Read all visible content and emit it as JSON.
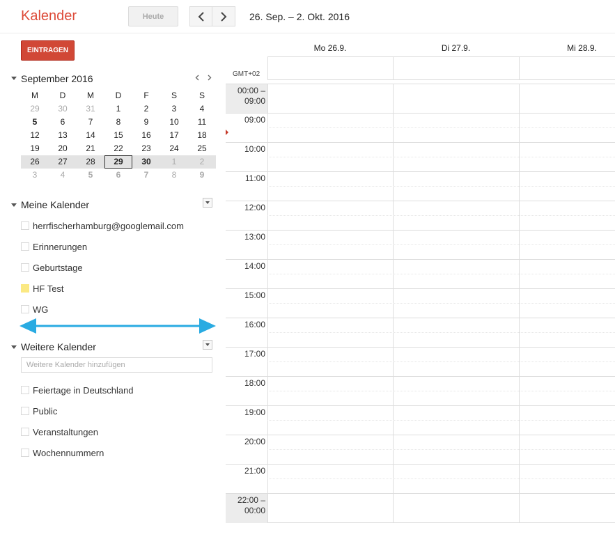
{
  "header": {
    "title": "Kalender",
    "today_label": "Heute",
    "date_range": "26. Sep. – 2. Okt. 2016"
  },
  "sidebar": {
    "create_label": "EINTRAGEN",
    "mini_calendar": {
      "title": "September 2016",
      "weekdays": [
        "M",
        "D",
        "M",
        "D",
        "F",
        "S",
        "S"
      ],
      "weeks": [
        [
          "29",
          "30",
          "31",
          "1",
          "2",
          "3",
          "4"
        ],
        [
          "5",
          "6",
          "7",
          "8",
          "9",
          "10",
          "11"
        ],
        [
          "12",
          "13",
          "14",
          "15",
          "16",
          "17",
          "18"
        ],
        [
          "19",
          "20",
          "21",
          "22",
          "23",
          "24",
          "25"
        ],
        [
          "26",
          "27",
          "28",
          "29",
          "30",
          "1",
          "2"
        ],
        [
          "3",
          "4",
          "5",
          "6",
          "7",
          "8",
          "9"
        ]
      ]
    },
    "my_calendars": {
      "title": "Meine Kalender",
      "items": [
        {
          "label": "herrfischerhamburg@googlemail.com",
          "color": "#ffffff"
        },
        {
          "label": "Erinnerungen",
          "color": "#ffffff"
        },
        {
          "label": "Geburtstage",
          "color": "#ffffff"
        },
        {
          "label": "HF Test",
          "color": "#fbe983"
        },
        {
          "label": "WG",
          "color": "#ffffff"
        }
      ]
    },
    "other_calendars": {
      "title": "Weitere Kalender",
      "add_placeholder": "Weitere Kalender hinzufügen",
      "items": [
        {
          "label": "Feiertage in Deutschland"
        },
        {
          "label": "Public"
        },
        {
          "label": "Veranstaltungen"
        },
        {
          "label": "Wochennummern"
        }
      ]
    },
    "arrow_color": "#29abe2"
  },
  "week": {
    "timezone": "GMT+02",
    "days": [
      "Mo 26.9.",
      "Di 27.9.",
      "Mi 28.9."
    ],
    "times": [
      "00:00 –\n09:00",
      "09:00",
      "10:00",
      "11:00",
      "12:00",
      "13:00",
      "14:00",
      "15:00",
      "16:00",
      "17:00",
      "18:00",
      "19:00",
      "20:00",
      "21:00",
      "22:00 –\n00:00"
    ]
  },
  "colors": {
    "brand": "#dd4b39",
    "create_button": "#d14836",
    "now_marker": "#c53929"
  }
}
